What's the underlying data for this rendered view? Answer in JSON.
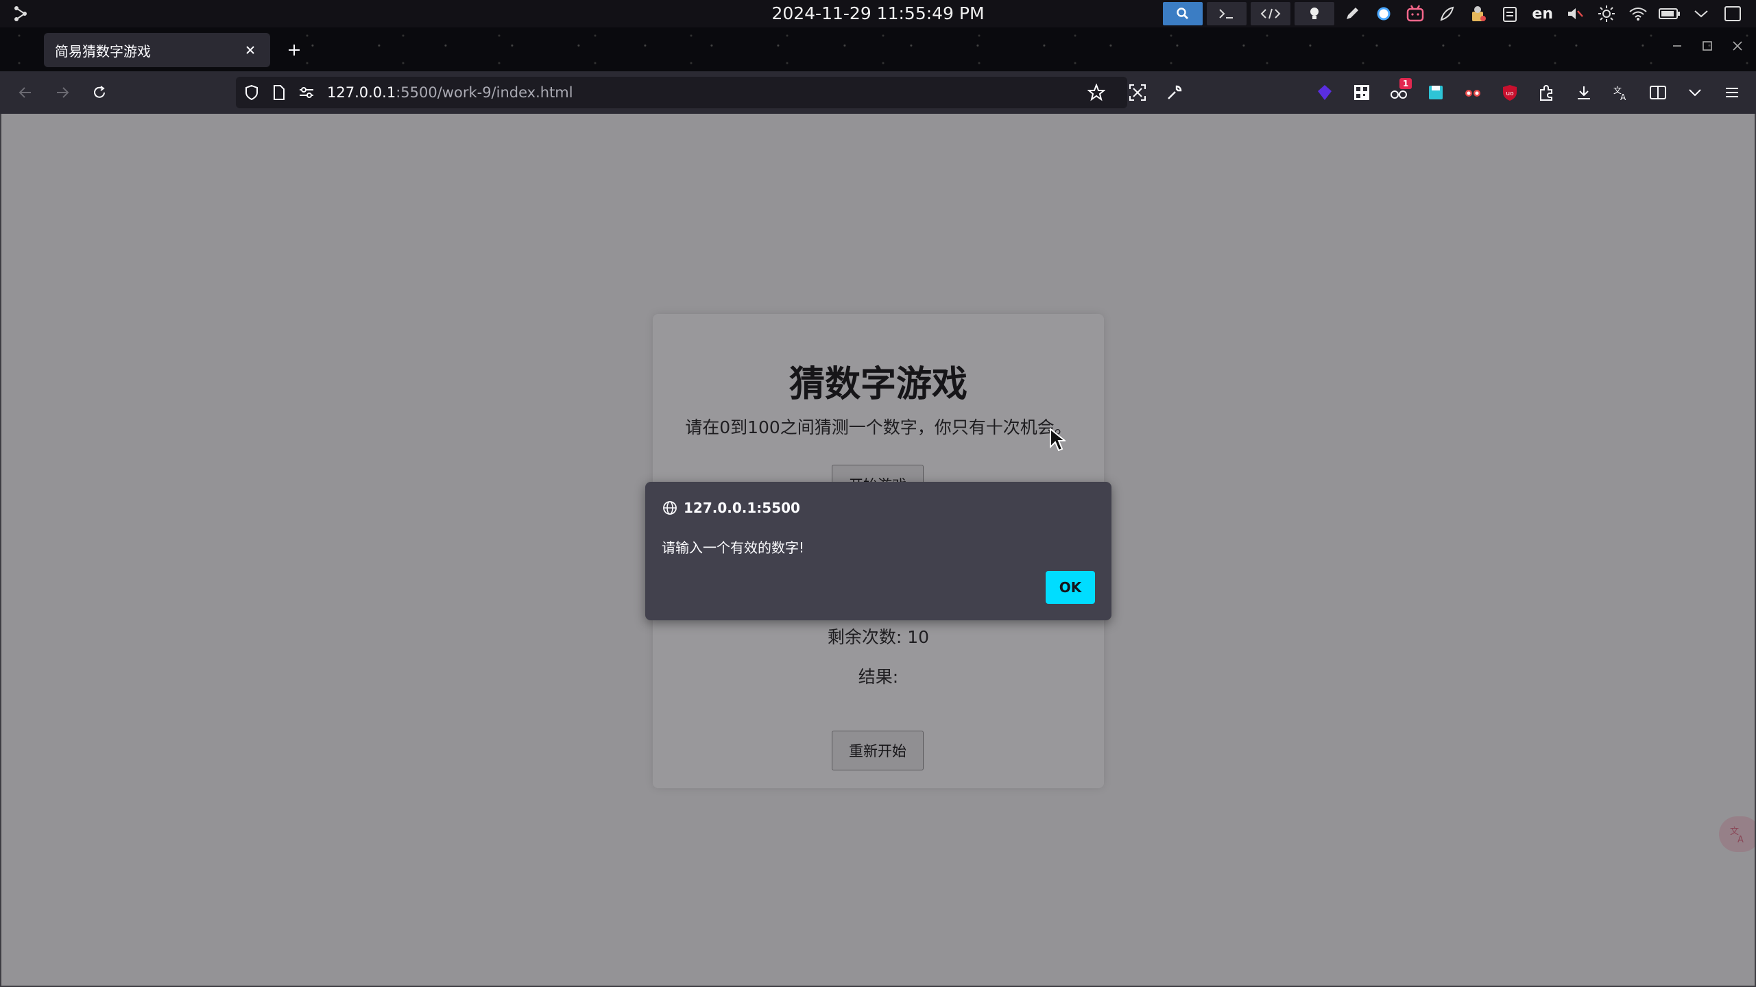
{
  "system_bar": {
    "datetime": "2024-11-29 11:55:49 PM",
    "language": "en",
    "icons": [
      "app-launcher-icon",
      "search-icon",
      "terminal-icon",
      "code-icon",
      "bulb-icon",
      "pen-icon",
      "circle-indicator-icon",
      "bilibili-icon",
      "feather-icon",
      "keyring-icon",
      "clipboard-icon",
      "mute-icon",
      "brightness-icon",
      "wifi-icon",
      "battery-icon",
      "chevron-down-icon",
      "desktop-icon"
    ]
  },
  "browser": {
    "tab": {
      "title": "简易猜数字游戏"
    },
    "address": {
      "host": "127.0.0.1",
      "rest": ":5500/work-9/index.html"
    },
    "extension_badge": "1"
  },
  "page": {
    "title": "猜数字游戏",
    "description": "请在0到100之间猜测一个数字，你只有十次机会。",
    "start_button": "开始游戏",
    "remaining": "剩余次数: 10",
    "result": "结果:",
    "restart_button": "重新开始"
  },
  "dialog": {
    "origin": "127.0.0.1:5500",
    "message": "请输入一个有效的数字!",
    "ok_label": "OK"
  },
  "colors": {
    "accent": "#00ddff",
    "dialog_bg": "#42414d",
    "toolbar_bg": "#2b2a33"
  }
}
